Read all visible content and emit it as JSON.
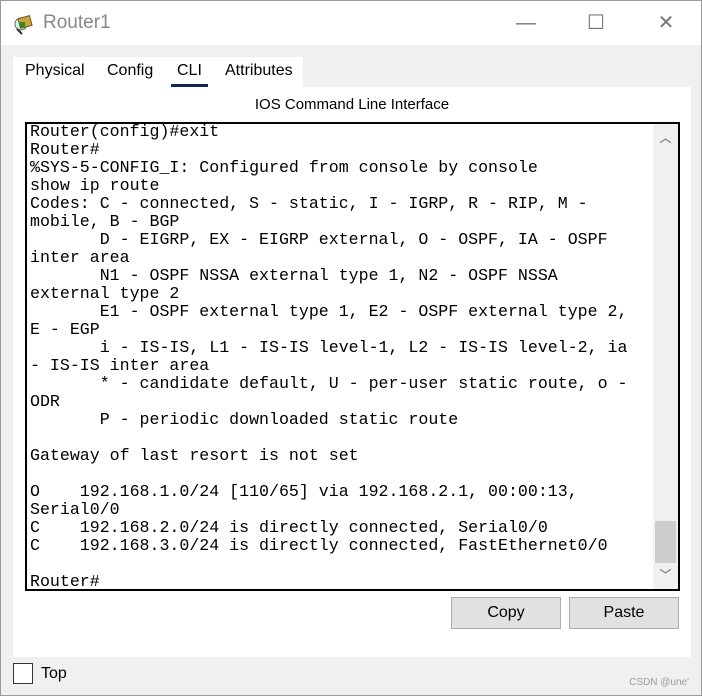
{
  "window": {
    "title": "Router1",
    "minimize_icon": "minimize-icon",
    "maximize_icon": "maximize-icon",
    "close_icon": "close-icon"
  },
  "tabs": [
    {
      "label": "Physical"
    },
    {
      "label": "Config"
    },
    {
      "label": "CLI",
      "active": true
    },
    {
      "label": "Attributes"
    }
  ],
  "panel": {
    "title": "IOS Command Line Interface"
  },
  "terminal": {
    "lines": [
      "Router(config)#exit",
      "Router#",
      "%SYS-5-CONFIG_I: Configured from console by console",
      "show ip route",
      "Codes: C - connected, S - static, I - IGRP, R - RIP, M -",
      "mobile, B - BGP",
      "       D - EIGRP, EX - EIGRP external, O - OSPF, IA - OSPF",
      "inter area",
      "       N1 - OSPF NSSA external type 1, N2 - OSPF NSSA",
      "external type 2",
      "       E1 - OSPF external type 1, E2 - OSPF external type 2,",
      "E - EGP",
      "       i - IS-IS, L1 - IS-IS level-1, L2 - IS-IS level-2, ia",
      "- IS-IS inter area",
      "       * - candidate default, U - per-user static route, o -",
      "ODR",
      "       P - periodic downloaded static route",
      "",
      "Gateway of last resort is not set",
      "",
      "O    192.168.1.0/24 [110/65] via 192.168.2.1, 00:00:13,",
      "Serial0/0",
      "C    192.168.2.0/24 is directly connected, Serial0/0",
      "C    192.168.3.0/24 is directly connected, FastEthernet0/0",
      "",
      "Router#"
    ],
    "scroll_position": 0.95
  },
  "buttons": {
    "copy": "Copy",
    "paste": "Paste"
  },
  "top_checkbox": {
    "label": "Top",
    "checked": false
  },
  "watermark": "CSDN @une'"
}
